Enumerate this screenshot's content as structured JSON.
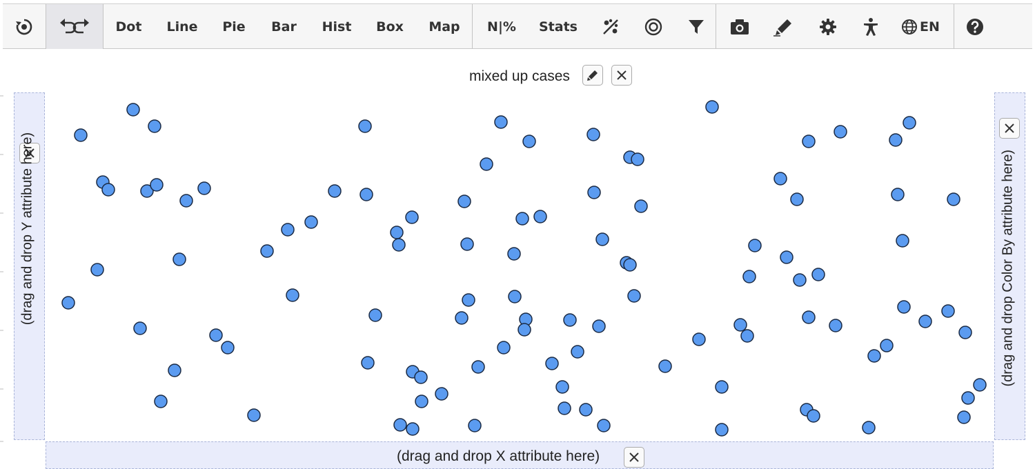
{
  "toolbar": {
    "dot": "Dot",
    "line": "Line",
    "pie": "Pie",
    "bar": "Bar",
    "hist": "Hist",
    "box": "Box",
    "map": "Map",
    "counts": "N|%",
    "stats": "Stats",
    "lang": "EN"
  },
  "graph": {
    "title": "mixed up cases",
    "y_placeholder": "(drag and drop Y attribute here)",
    "x_placeholder": "(drag and drop X attribute here)",
    "color_placeholder": "(drag and drop Color By attribute here)"
  },
  "colors": {
    "point_fill": "#5b9bf0",
    "point_stroke": "#1a2a44",
    "dropzone": "#e9ecfb"
  }
}
